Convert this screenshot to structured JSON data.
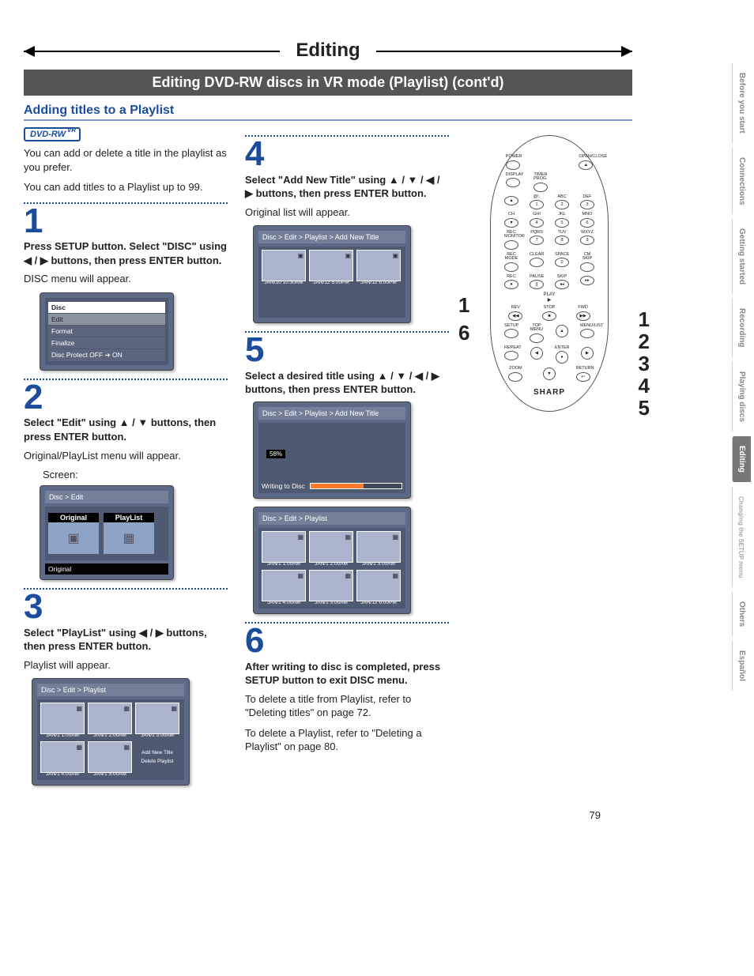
{
  "banner": "Editing",
  "subbanner": "Editing DVD-RW discs in VR mode (Playlist) (cont'd)",
  "section_title": "Adding titles to a Playlist",
  "disc_badge": "DVD-RW",
  "disc_badge_sup": "VR",
  "intro1": "You can add or delete a title in the playlist as you prefer.",
  "intro2": "You can add titles to a Playlist up to 99.",
  "steps": {
    "1": {
      "num": "1",
      "bold": "Press SETUP button. Select \"DISC\" using ◀ / ▶ buttons, then press ENTER button.",
      "note": "DISC menu will appear.",
      "menu_title": "Disc",
      "menu_items": [
        "Edit",
        "Format",
        "Finalize",
        "Disc Protect OFF ➔ ON"
      ]
    },
    "2": {
      "num": "2",
      "bold": "Select \"Edit\" using ▲ / ▼ buttons, then press ENTER button.",
      "note": "Original/PlayList menu will appear.",
      "screen_label": "Screen:",
      "breadcrumb": "Disc > Edit",
      "tabs": {
        "original": "Original",
        "playlist": "PlayList"
      },
      "footer": "Original"
    },
    "3": {
      "num": "3",
      "bold": "Select \"PlayList\" using ◀ / ▶ buttons, then press ENTER button.",
      "note": "Playlist will appear.",
      "breadcrumb": "Disc > Edit > Playlist",
      "thumbs": [
        "JAN/1  1:00AM",
        "JAN/1  2:00AM",
        "JAN/1  3:00AM",
        "JAN/1  4:00AM",
        "JAN/1  5:00AM"
      ],
      "options": {
        "add": "Add New Title",
        "delete": "Delete Playlist"
      }
    },
    "4": {
      "num": "4",
      "bold": "Select \"Add New Title\" using ▲ / ▼ / ◀ / ▶ buttons, then press ENTER button.",
      "note": "Original list will appear.",
      "breadcrumb": "Disc > Edit > Playlist > Add New Title",
      "thumbs": [
        "JAN/10 10:30AM",
        "JAN/12  5:00PM",
        "JAN/12  6:00PM"
      ]
    },
    "5": {
      "num": "5",
      "bold": "Select a desired title using ▲ / ▼ / ◀ / ▶ buttons, then press ENTER button.",
      "breadcrumb": "Disc > Edit > Playlist > Add New Title",
      "writing": "Writing to Disc",
      "pct": "58%",
      "breadcrumb2": "Disc > Edit > Playlist",
      "thumbs2": [
        "JAN/1  1:00AM",
        "JAN/1  2:00AM",
        "JAN/1  3:00AM",
        "JAN/1  4:00AM",
        "JAN/1  5:00AM",
        "JAN/12  6:00PM"
      ]
    },
    "6": {
      "num": "6",
      "bold": "After writing to disc is completed, press SETUP button to exit DISC menu.",
      "para1": "To delete a title from Playlist, refer to \"Deleting titles\" on page 72.",
      "para2": "To delete a Playlist, refer to \"Deleting a Playlist\" on page 80."
    }
  },
  "remote": {
    "top_left": "POWER",
    "top_right": "OPEN/CLOSE",
    "r1": [
      "DISPLAY",
      "TIMER PROG."
    ],
    "r2_labels": [
      "",
      "@!.",
      "ABC",
      "DEF"
    ],
    "r2": [
      "▲",
      "1",
      "2",
      "3"
    ],
    "r3_labels": [
      "CH",
      "GHI",
      "JKL",
      "MNO"
    ],
    "r3": [
      "▼",
      "4",
      "5",
      "6"
    ],
    "r4_labels": [
      "REC MONITOR",
      "PQRS",
      "TUV",
      "WXYZ"
    ],
    "r4": [
      "",
      "7",
      "8",
      "9"
    ],
    "r5_labels": [
      "REC MODE",
      "CLEAR",
      "SPACE",
      "CM SKIP"
    ],
    "r5": [
      "",
      "",
      "0",
      ""
    ],
    "r6_labels": [
      "REC",
      "PAUSE",
      "",
      "SKIP"
    ],
    "r6": [
      "●",
      "∥",
      "◂◂",
      "▸▸"
    ],
    "play": "PLAY",
    "rev": "REV",
    "fwd": "FWD",
    "stop": "STOP",
    "r8_labels": [
      "SETUP",
      "TOP MENU",
      "",
      "MENU/LIST"
    ],
    "r8": [
      "",
      "",
      "▲",
      ""
    ],
    "r9_labels": [
      "REPEAT",
      "",
      "ENTER",
      ""
    ],
    "r9": [
      "",
      "◀",
      "●",
      "▶"
    ],
    "r10_labels": [
      "ZOOM",
      "",
      "",
      "RETURN"
    ],
    "r10": [
      "",
      "",
      "▼",
      "↩"
    ],
    "brand": "SHARP"
  },
  "callouts_left": {
    "one": "1",
    "six": "6"
  },
  "callouts_right": [
    "1",
    "2",
    "3",
    "4",
    "5"
  ],
  "side_tabs": [
    "Before you start",
    "Connections",
    "Getting started",
    "Recording",
    "Playing discs",
    "Editing",
    "Changing the SETUP menu",
    "Others",
    "Español"
  ],
  "page_number": "79"
}
